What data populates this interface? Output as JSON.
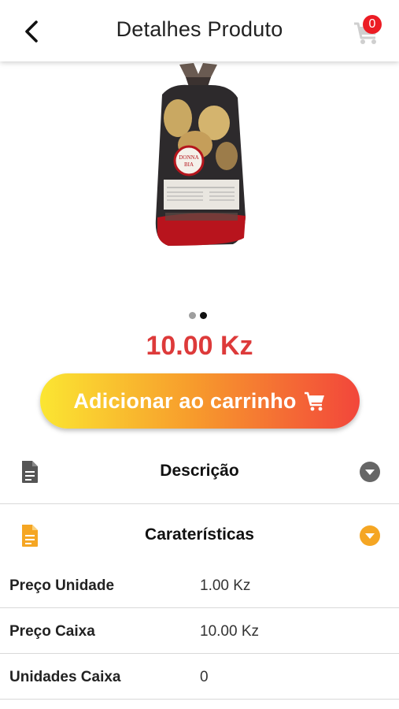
{
  "header": {
    "title": "Detalhes Produto",
    "cart_count": "0"
  },
  "product": {
    "image_name": "product-photo",
    "price": "10.00 Kz",
    "add_to_cart_label": "Adicionar ao carrinho",
    "carousel": {
      "count": 2,
      "active_index": 1
    }
  },
  "sections": {
    "description": {
      "title": "Descrição",
      "expanded": false,
      "icon": "description-icon"
    },
    "characteristics": {
      "title": "Caraterísticas",
      "expanded": true,
      "icon": "characteristics-icon"
    }
  },
  "characteristics": [
    {
      "label": "Preço Unidade",
      "value": "1.00 Kz"
    },
    {
      "label": "Preço Caixa",
      "value": "10.00 Kz"
    },
    {
      "label": "Unidades Caixa",
      "value": "0"
    }
  ],
  "colors": {
    "price_red": "#dd3a3a",
    "accent_orange": "#f5a623",
    "grey_icon": "#555555",
    "badge_red": "#ec1c24"
  }
}
